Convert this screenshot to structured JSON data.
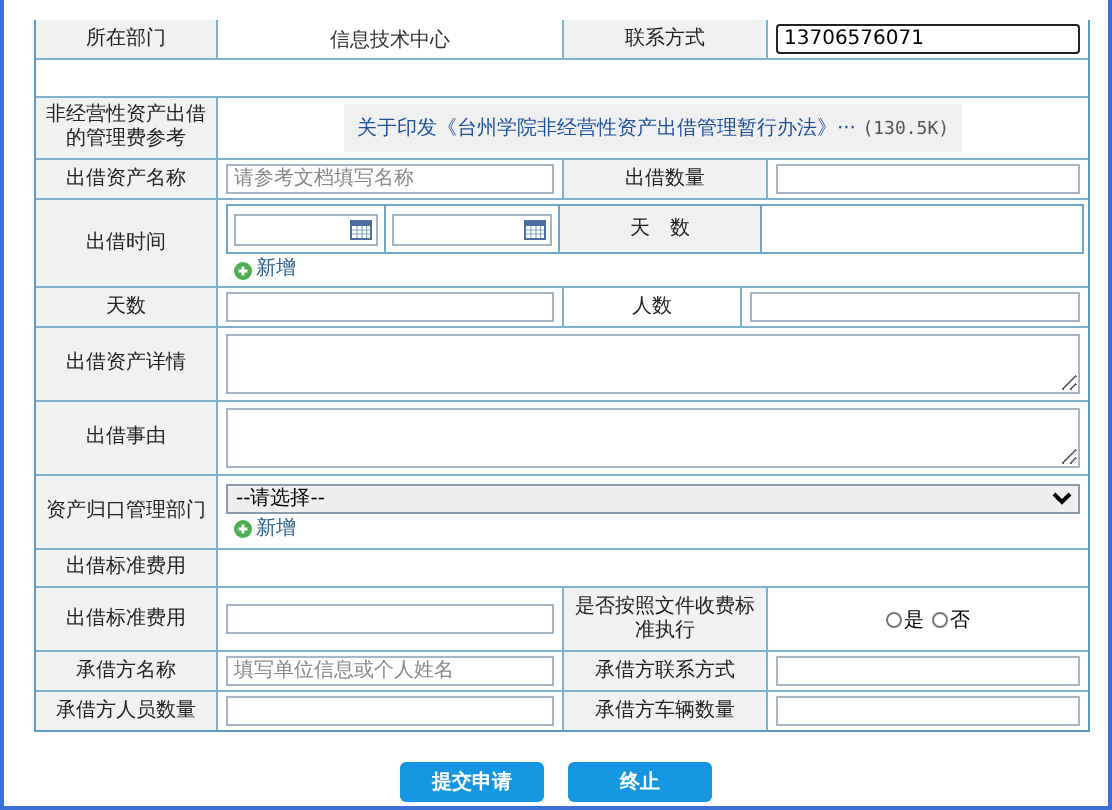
{
  "rows": [
    {
      "cells": [
        {
          "kind": "label",
          "text": "所在部门"
        },
        {
          "kind": "text",
          "text": "信息技术中心"
        },
        {
          "kind": "label",
          "text": "联系方式"
        },
        {
          "kind": "input",
          "value": "13706576071",
          "focused": true
        }
      ]
    },
    {
      "cells": [
        {
          "kind": "blank"
        }
      ]
    },
    {
      "cells": [
        {
          "kind": "label",
          "text": "非经营性资产出借的管理费参考"
        },
        {
          "kind": "doc",
          "text": "关于印发《台州学院非经营性资产出借管理暂行办法》···",
          "size": "(130.5K)"
        }
      ]
    },
    {
      "cells": [
        {
          "kind": "label",
          "text": "出借资产名称"
        },
        {
          "kind": "input",
          "placeholder": "请参考文档填写名称",
          "focused": false
        },
        {
          "kind": "label",
          "text": "出借数量"
        },
        {
          "kind": "input",
          "focused": false
        }
      ]
    },
    {
      "cells": [
        {
          "kind": "label",
          "text": "出借时间"
        },
        {
          "kind": "dates",
          "days_label": "天　数",
          "add": "新增"
        }
      ]
    },
    {
      "cells": [
        {
          "kind": "label",
          "text": "天数"
        },
        {
          "kind": "input",
          "focused": false
        },
        {
          "kind": "plain",
          "text": "人数"
        },
        {
          "kind": "input",
          "focused": false
        }
      ]
    },
    {
      "cells": [
        {
          "kind": "label",
          "text": "出借资产详情"
        },
        {
          "kind": "textarea"
        }
      ]
    },
    {
      "cells": [
        {
          "kind": "label",
          "text": "出借事由"
        },
        {
          "kind": "textarea"
        }
      ]
    },
    {
      "cells": [
        {
          "kind": "label",
          "text": "资产归口管理部门"
        },
        {
          "kind": "select",
          "value": "--请选择--",
          "add": "新增"
        }
      ]
    },
    {
      "cells": [
        {
          "kind": "label",
          "text": "出借标准费用"
        },
        {
          "kind": "blank"
        }
      ]
    },
    {
      "cells": [
        {
          "kind": "label",
          "text": "出借标准费用"
        },
        {
          "kind": "input",
          "focused": false
        },
        {
          "kind": "label",
          "text": "是否按照文件收费标准执行"
        },
        {
          "kind": "radios",
          "options": [
            {
              "label": "是",
              "selected": false
            },
            {
              "label": "否",
              "selected": false
            }
          ]
        }
      ]
    },
    {
      "cells": [
        {
          "kind": "label",
          "text": "承借方名称"
        },
        {
          "kind": "input",
          "placeholder": "填写单位信息或个人姓名",
          "focused": false
        },
        {
          "kind": "label",
          "text": "承借方联系方式"
        },
        {
          "kind": "input",
          "focused": false
        }
      ]
    },
    {
      "cells": [
        {
          "kind": "label",
          "text": "承借方人员数量"
        },
        {
          "kind": "input",
          "focused": false
        },
        {
          "kind": "label",
          "text": "承借方车辆数量"
        },
        {
          "kind": "input",
          "focused": false
        }
      ]
    }
  ],
  "buttons": [
    {
      "label": "提交申请"
    },
    {
      "label": "终止"
    }
  ]
}
